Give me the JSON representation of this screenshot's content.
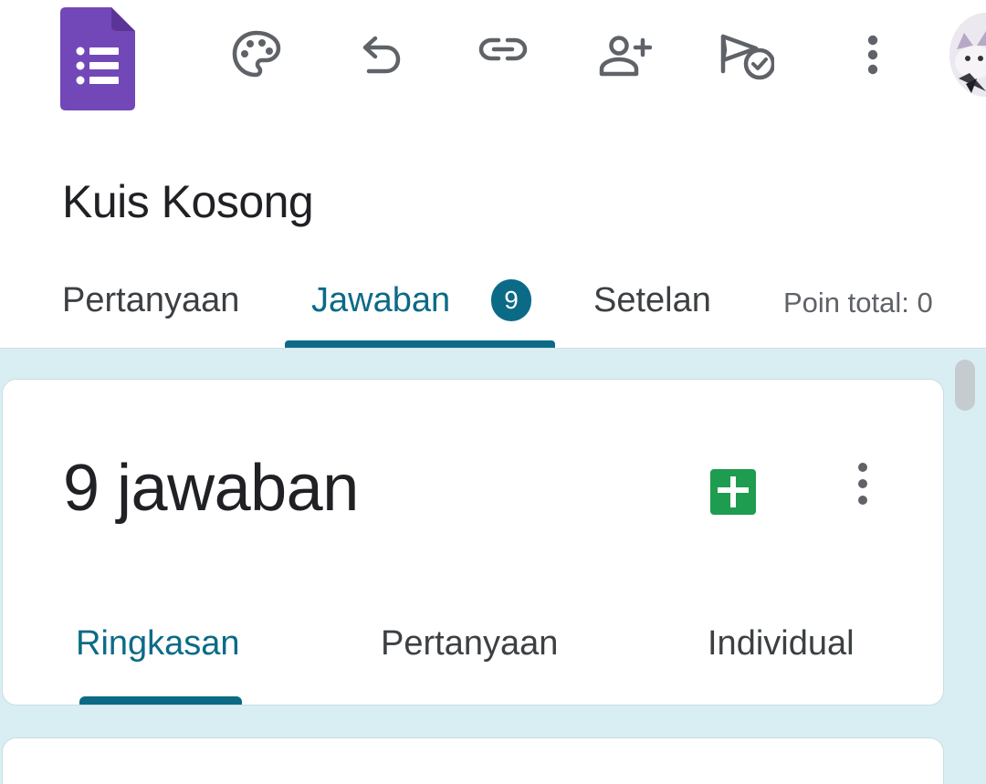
{
  "toolbar": {
    "icons": [
      "forms-logo-icon",
      "palette-icon",
      "undo-icon",
      "link-icon",
      "add-collaborator-icon",
      "send-icon",
      "more-vert-icon",
      "avatar"
    ]
  },
  "form": {
    "title": "Kuis Kosong"
  },
  "tabs": {
    "questions": "Pertanyaan",
    "responses": "Jawaban",
    "responses_badge": "9",
    "settings": "Setelan",
    "total_points": "Poin total: 0",
    "active": "responses"
  },
  "responses": {
    "count_label": "9 jawaban",
    "subtabs": {
      "summary": "Ringkasan",
      "question": "Pertanyaan",
      "individual": "Individual",
      "active": "summary"
    }
  },
  "colors": {
    "accent": "#0b6b87",
    "forms_purple": "#7248b9",
    "sheets_green": "#1e9c4f",
    "content_bg": "#d9eef3"
  }
}
